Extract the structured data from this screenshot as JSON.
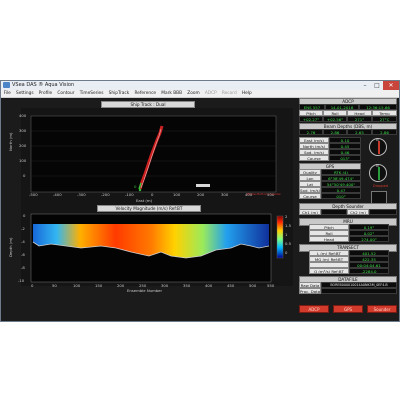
{
  "window": {
    "title": "VSea DAS ® Aqua Vision",
    "controls": {
      "minimize": "–",
      "maximize": "□",
      "close": "✕"
    }
  },
  "menu": [
    "File",
    "Settings",
    "Profile",
    "Contour",
    "TimeSeries",
    "ShipTrack",
    "Reference",
    "Mark BBB",
    "Zoom",
    "ADCP",
    "Record",
    "Help"
  ],
  "menu_disabled": [
    "ADCP",
    "Record"
  ],
  "ship_track": {
    "title": "Ship Track : Dual",
    "y_label": "North (m)",
    "x_label": "East (m)",
    "y_ticks": [
      "400",
      "300",
      "200",
      "100",
      "0"
    ],
    "x_ticks": [
      "-500",
      "-400",
      "-300",
      "-200",
      "-100",
      "0",
      "100",
      "200",
      "300",
      "400",
      "500"
    ],
    "start_label": "0",
    "legend_text": "BT/Vel Bottom Coastal"
  },
  "velocity": {
    "title": "Velocity Magnitude (m/s) Ref:BT",
    "y_label": "Depth (m)",
    "x_label": "Ensemble Number",
    "y_ticks": [
      "0",
      "-2",
      "-4",
      "-6",
      "-8",
      "-10"
    ],
    "x_ticks": [
      "0",
      "50",
      "100",
      "150",
      "200",
      "250",
      "300",
      "350",
      "400",
      "450",
      "500",
      "550"
    ],
    "colorbar_ticks": [
      "2",
      "1.5",
      "1",
      "0.5",
      "0"
    ]
  },
  "adcp": {
    "title": "ADCP",
    "row1": [
      "ENS 557",
      "14-01-2016",
      "12:36:15.66"
    ],
    "headers": [
      "Pitch",
      "Roll",
      "Head",
      "Temp"
    ],
    "values": [
      "+02.27°",
      "+02.56°",
      "271°",
      "27°C"
    ]
  },
  "beam_depths": {
    "title": "Beam Depths (DBS, m)",
    "values": [
      "2.76",
      "2.86",
      "2.65",
      "2.86"
    ]
  },
  "velocity_panel": {
    "rows": [
      {
        "label": "East (m/s)",
        "value": "0.10"
      },
      {
        "label": "North (m/s)",
        "value": "0.45"
      },
      {
        "label": "Spd. (m/s)",
        "value": "0.46"
      },
      {
        "label": "Course",
        "value": "013°"
      }
    ]
  },
  "gps": {
    "title": "GPS",
    "rows": [
      {
        "label": "Quality",
        "value": "RTK (4)"
      },
      {
        "label": "Lon",
        "value": "6°38'49.474\""
      },
      {
        "label": "Lat",
        "value": "54°50'49.400\""
      },
      {
        "label": "Spd. (m/s)",
        "value": "0.47"
      },
      {
        "label": "Course",
        "value": "010°"
      }
    ]
  },
  "compass_labels": {
    "n": "N",
    "s": "S"
  },
  "gps_status": "Dropped",
  "depth_sounder": {
    "title": "Depth Sounder",
    "ch1_label": "Ch1 (m)",
    "ch2_label": "Ch2 (m)",
    "ch1_value": "",
    "ch2_value": ""
  },
  "mru": {
    "title": "MRU",
    "rows": [
      {
        "label": "Pitch",
        "value": "0.19°"
      },
      {
        "label": "Roll",
        "value": "0.02°"
      },
      {
        "label": "Head",
        "value": "274.00°"
      }
    ]
  },
  "transect": {
    "title": "TRANSECT",
    "rows": [
      {
        "label": "L (m) Ref:BT",
        "value": "401.52"
      },
      {
        "label": "MG (m) Ref:BT",
        "value": "422.35"
      },
      {
        "label": "",
        "value": "00:04:04.61"
      },
      {
        "label": "Q (m³/s) Ref:BT",
        "value": "-2284.0"
      }
    ]
  },
  "datafile": {
    "title": "DATAFILE",
    "raw_label": "Raw Data",
    "raw_value": "BOREB000010014A0NK5M_0EF4.B",
    "proc_label": "Proc. Data",
    "proc_value": ""
  },
  "buttons": [
    "ADCP",
    "GPS",
    "Sounder"
  ],
  "colors": {
    "accent_red": "#d23a2c",
    "value_green": "#3ce04a",
    "panel_bg": "#1b1b1b"
  }
}
